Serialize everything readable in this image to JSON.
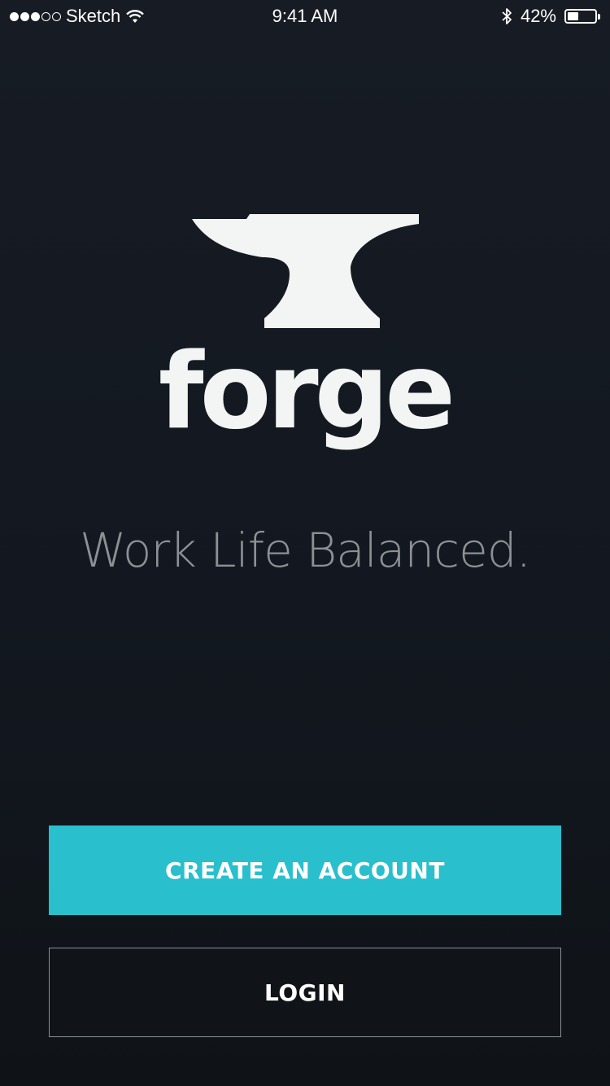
{
  "status_bar": {
    "carrier": "Sketch",
    "time": "9:41 AM",
    "battery_percent": "42%",
    "battery_level": 0.42,
    "signal_bars_filled": 3,
    "signal_bars_total": 5,
    "icons": [
      "signal-dots",
      "wifi-icon",
      "bluetooth-icon",
      "battery-icon"
    ]
  },
  "brand": {
    "logo_icon": "anvil-icon",
    "wordmark": "forge",
    "tagline": "Work Life Balanced."
  },
  "actions": {
    "create_account_label": "CREATE AN ACCOUNT",
    "login_label": "LOGIN"
  },
  "colors": {
    "background": "#151a21",
    "accent": "#29bfcd",
    "logo": "#f3f5f4",
    "tagline": "#8d9094",
    "login_border": "#8b9096"
  }
}
